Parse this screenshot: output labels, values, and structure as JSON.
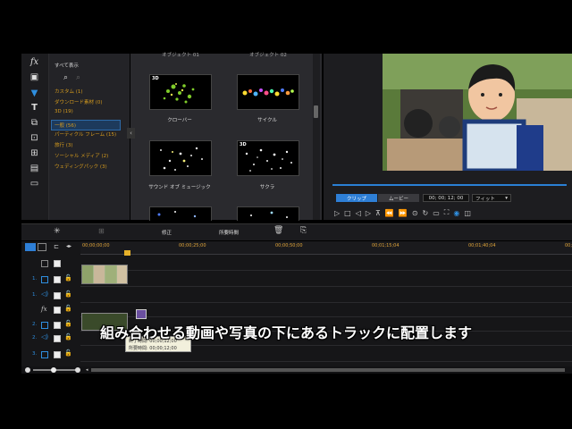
{
  "library": {
    "show_all": "すべて表示",
    "categories": [
      {
        "label": "カスタム  (1)",
        "selected": false
      },
      {
        "label": "ダウンロード素材  (0)",
        "selected": false
      },
      {
        "label": "3D  (19)",
        "selected": false
      },
      {
        "label": "一般  (56)",
        "selected": true
      },
      {
        "label": "パーティクル フレーム  (15)",
        "selected": false
      },
      {
        "label": "旅行  (3)",
        "selected": false
      },
      {
        "label": "ソーシャル メディア  (2)",
        "selected": false
      },
      {
        "label": "ウェディングパック  (3)",
        "selected": false
      }
    ]
  },
  "thumbs": {
    "top_labels": [
      "オブジェクト 01",
      "オブジェクト 02"
    ],
    "items": [
      {
        "label": "クローバー",
        "badge": "3D"
      },
      {
        "label": "サイクル",
        "badge": ""
      },
      {
        "label": "サウンド オブ ミュージック",
        "badge": ""
      },
      {
        "label": "サクラ",
        "badge": "3D"
      }
    ]
  },
  "preview": {
    "clip_tab": "クリップ",
    "movie_tab": "ムービー",
    "timecode": "00; 00; 12; 00",
    "fit_select": "フィット"
  },
  "timeline_toolbar": {
    "fix_label": "修正",
    "duration_label": "所要時間"
  },
  "ruler": {
    "ticks": [
      "00;00;00;00",
      "00;00;25;00",
      "00;00;50;00",
      "00;01;15;04",
      "00;01;40;04",
      "00;0"
    ]
  },
  "tracks": {
    "labels": [
      "1.",
      "1.",
      "fx",
      "2.",
      "2.",
      "3."
    ]
  },
  "tooltip": {
    "end_time": "終了時間: 00;00;12;00",
    "duration": "所要時間: 00;00;12;00"
  },
  "caption": "組み合わせる動画や写真の下にあるトラックに配置します"
}
